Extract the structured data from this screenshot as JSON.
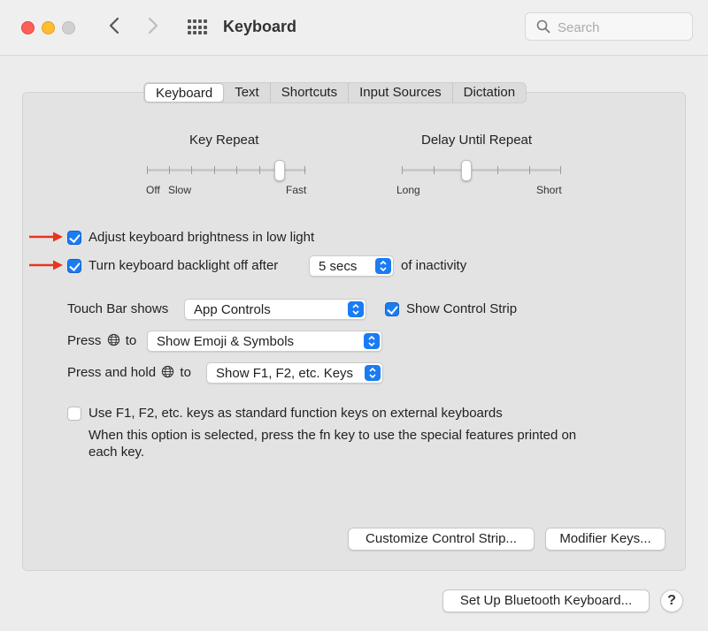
{
  "window": {
    "title": "Keyboard",
    "search": {
      "placeholder": "Search",
      "value": ""
    }
  },
  "tabs": [
    {
      "label": "Keyboard",
      "active": true
    },
    {
      "label": "Text",
      "active": false
    },
    {
      "label": "Shortcuts",
      "active": false
    },
    {
      "label": "Input Sources",
      "active": false
    },
    {
      "label": "Dictation",
      "active": false
    }
  ],
  "key_repeat": {
    "label": "Key Repeat",
    "min_label": "Off",
    "slow_label": "Slow",
    "max_label": "Fast",
    "value_step": 6,
    "steps": 8
  },
  "delay_until_repeat": {
    "label": "Delay Until Repeat",
    "min_label": "Long",
    "max_label": "Short",
    "value_step": 2,
    "steps": 6
  },
  "brightness": {
    "label": "Adjust keyboard brightness in low light",
    "checked": true
  },
  "backlight": {
    "label": "Turn keyboard backlight off after",
    "checked": true,
    "value": "5 secs",
    "suffix": "of inactivity"
  },
  "touch_bar": {
    "label": "Touch Bar shows",
    "value": "App Controls",
    "control_strip_label": "Show Control Strip",
    "control_strip_checked": true
  },
  "press_globe": {
    "label_before": "Press",
    "label_after": "to",
    "value": "Show Emoji & Symbols"
  },
  "press_hold_globe": {
    "label_before": "Press and hold",
    "label_after": "to",
    "value": "Show F1, F2, etc. Keys"
  },
  "function_keys": {
    "label": "Use F1, F2, etc. keys as standard function keys on external keyboards",
    "checked": false,
    "description": "When this option is selected, press the fn key to use the special features printed on",
    "description_line2": "each key."
  },
  "buttons": {
    "customize": "Customize Control Strip...",
    "modifier": "Modifier Keys...",
    "bluetooth": "Set Up Bluetooth Keyboard...",
    "help": "?"
  },
  "colors": {
    "accent": "#1b7cf2",
    "annotation_arrow": "#e8351e"
  }
}
